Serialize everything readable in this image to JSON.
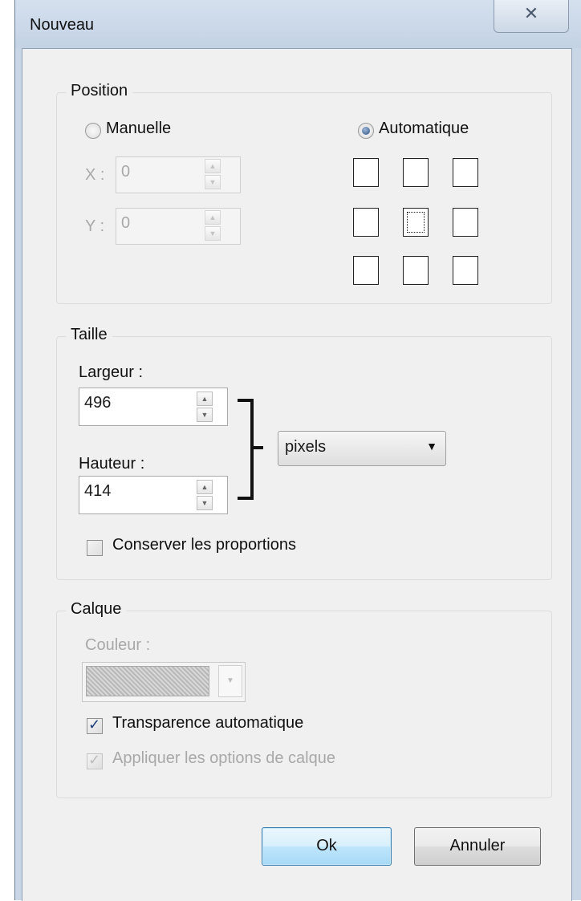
{
  "window": {
    "title": "Nouveau",
    "close_glyph": "✕"
  },
  "position": {
    "legend": "Position",
    "manual_label": "Manuelle",
    "auto_label": "Automatique",
    "manual_checked": false,
    "auto_checked": true,
    "x_label": "X :",
    "x_value": "0",
    "y_label": "Y :",
    "y_value": "0",
    "anchor_selected": "middle-center"
  },
  "size": {
    "legend": "Taille",
    "width_label": "Largeur :",
    "width_value": "496",
    "height_label": "Hauteur :",
    "height_value": "414",
    "unit": "pixels",
    "keep_ratio_label": "Conserver les proportions",
    "keep_ratio_checked": false
  },
  "layer": {
    "legend": "Calque",
    "color_label": "Couleur :",
    "auto_transparency_label": "Transparence automatique",
    "auto_transparency_checked": true,
    "apply_options_label": "Appliquer les options de calque",
    "apply_options_checked": true
  },
  "buttons": {
    "ok": "Ok",
    "cancel": "Annuler"
  },
  "icons": {
    "spin_up": "▲",
    "spin_down": "▼",
    "dropdown": "▼"
  }
}
